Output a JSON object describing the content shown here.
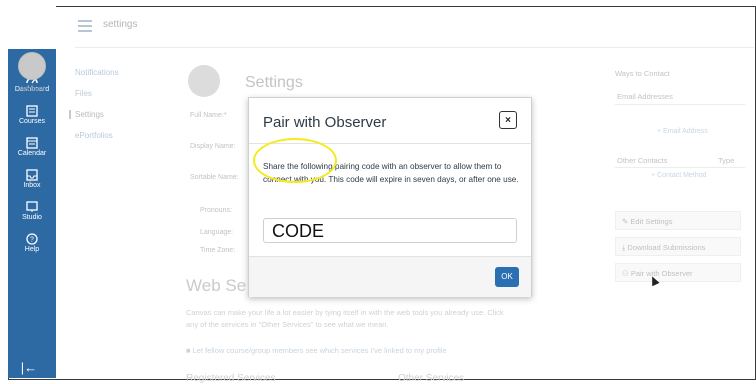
{
  "header": {
    "crumb": "settings"
  },
  "global_nav": {
    "account": "Account",
    "items": [
      {
        "label": "Dashboard",
        "icon": "dashboard-icon"
      },
      {
        "label": "Courses",
        "icon": "courses-icon"
      },
      {
        "label": "Calendar",
        "icon": "calendar-icon"
      },
      {
        "label": "Inbox",
        "icon": "inbox-icon"
      },
      {
        "label": "Studio",
        "icon": "studio-icon"
      },
      {
        "label": "Help",
        "icon": "help-icon"
      }
    ],
    "collapse": "|←"
  },
  "course_nav": {
    "items": [
      "Notifications",
      "Files",
      "Settings",
      "ePortfolios"
    ]
  },
  "settings_page": {
    "title": "Settings",
    "labels": [
      "Full Name:*",
      "Display Name:",
      "Sortable Name:",
      "Pronouns:",
      "Language:",
      "Time Zone:"
    ],
    "web_services_title": "Web Se",
    "web_services_text_1": "Canvas can make your life a lot easier by tying itself in with the web tools you already use. Click",
    "web_services_text_2": "any of the services in \"Other Services\" to see what we mean.",
    "checkbox_text": "Let fellow course/group members see which services I've linked to my profile",
    "registered": "Registered Services",
    "other_services": "Other Services"
  },
  "right_sidebar": {
    "ways_to_contact": "Ways to Contact",
    "email_addresses": "Email Addresses",
    "add_email": "+ Email Address",
    "other_contacts": "Other Contacts",
    "type": "Type",
    "add_contact": "+ Contact Method",
    "edit_settings": "Edit Settings",
    "download_submissions": "Download Submissions",
    "pair_with_observer": "Pair with Observer"
  },
  "modal": {
    "title": "Pair with Observer",
    "close_glyph": "×",
    "text": "Share the following pairing code with an observer to allow them to connect with you. This code will expire in seven days, or after one use.",
    "code": "CODE",
    "ok": "OK"
  },
  "colors": {
    "nav_blue": "#2d6aa3",
    "ok_blue": "#2a6fb2",
    "highlight": "#f5ea1c"
  }
}
